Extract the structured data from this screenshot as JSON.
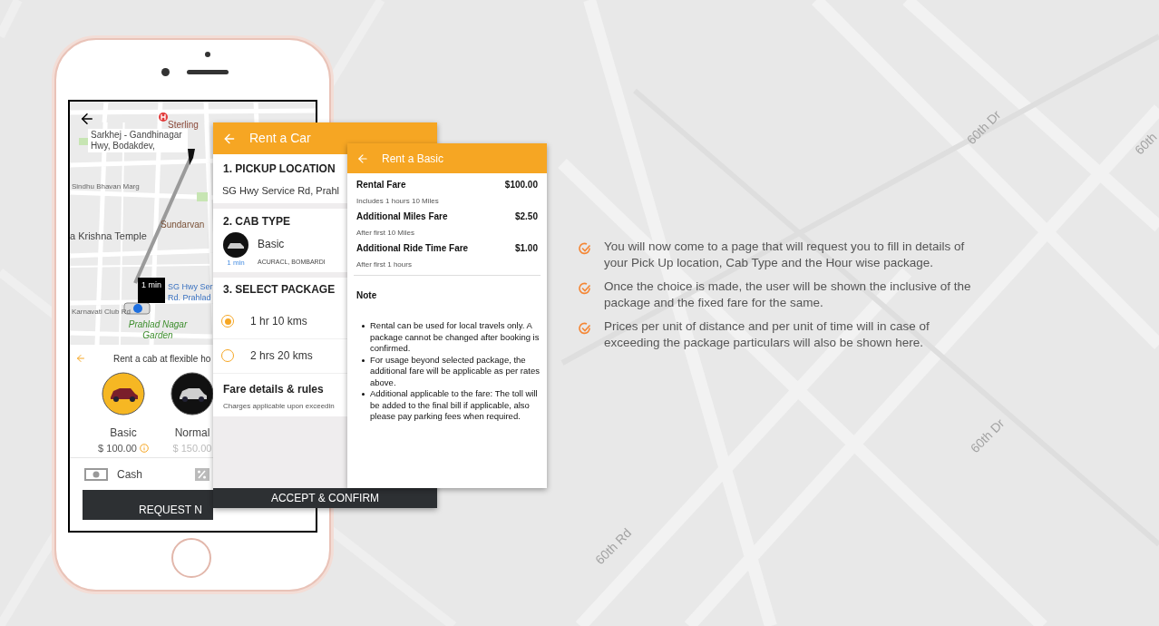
{
  "background_road_labels": [
    "60th Dr",
    "60th",
    "60th Dr",
    "60th Rd"
  ],
  "map_screen": {
    "map_labels": [
      "Sterling",
      "Sindhu Bhavan Marg",
      "Sundarvan",
      "a Krishna Temple",
      "Karnavati Club Rd",
      "Prahlad Nagar Garden"
    ],
    "destination": "Sarkhej - Gandhinagar Hwy, Bodakdev,",
    "eta_badge": "1 min",
    "pickup_label": "SG Hwy Ser Rd. Prahlad",
    "tagline": "Rent a cab at flexible ho",
    "cab_options": [
      {
        "name": "Basic",
        "price": "$ 100.00",
        "selected": true
      },
      {
        "name": "Normal",
        "price": "$ 150.00",
        "selected": false
      }
    ],
    "payment": "Cash",
    "request_button": "REQUEST N"
  },
  "rent_a_car": {
    "title": "Rent a Car",
    "pickup_heading": "1. PICKUP LOCATION",
    "pickup_address": "SG Hwy Service Rd, Prahl",
    "cab_heading": "2. CAB TYPE",
    "cab_name": "Basic",
    "cab_eta": "1 min",
    "cab_models": "ACURACL, BOMBARDI",
    "package_heading": "3. SELECT PACKAGE",
    "packages": [
      {
        "label": "1 hr 10 kms",
        "selected": true
      },
      {
        "label": "2 hrs 20 kms",
        "selected": false
      }
    ],
    "fare_heading": "Fare details & rules",
    "fare_note": "Charges applicable upon exceedin",
    "confirm_button": "ACCEPT & CONFIRM"
  },
  "rent_a_basic": {
    "title": "Rent a Basic",
    "fares": [
      {
        "name": "Rental Fare",
        "amount": "$100.00",
        "detail": "Includes 1 hours 10 Miles"
      },
      {
        "name": "Additional Miles Fare",
        "amount": "$2.50",
        "detail": "After first 10 Miles"
      },
      {
        "name": "Additional Ride Time Fare",
        "amount": "$1.00",
        "detail": "After first 1 hours"
      }
    ],
    "note_heading": "Note",
    "notes": [
      "Rental can be used for local travels only. A package cannot be changed after booking is confirmed.",
      "For usage beyond selected package, the additional fare will be applicable as per rates above.",
      "Additional applicable to the fare: The toll will be added to the final bill if applicable, also please pay parking fees when required."
    ]
  },
  "features": [
    "You will now come to a page that will request you to fill in details of your Pick Up location, Cab Type and the Hour wise package.",
    "Once the choice is made, the user will be shown the inclusive of the package and the fixed fare for the same.",
    "Prices per unit of distance and per unit of time will in case of exceeding the package particulars will also be shown here."
  ]
}
